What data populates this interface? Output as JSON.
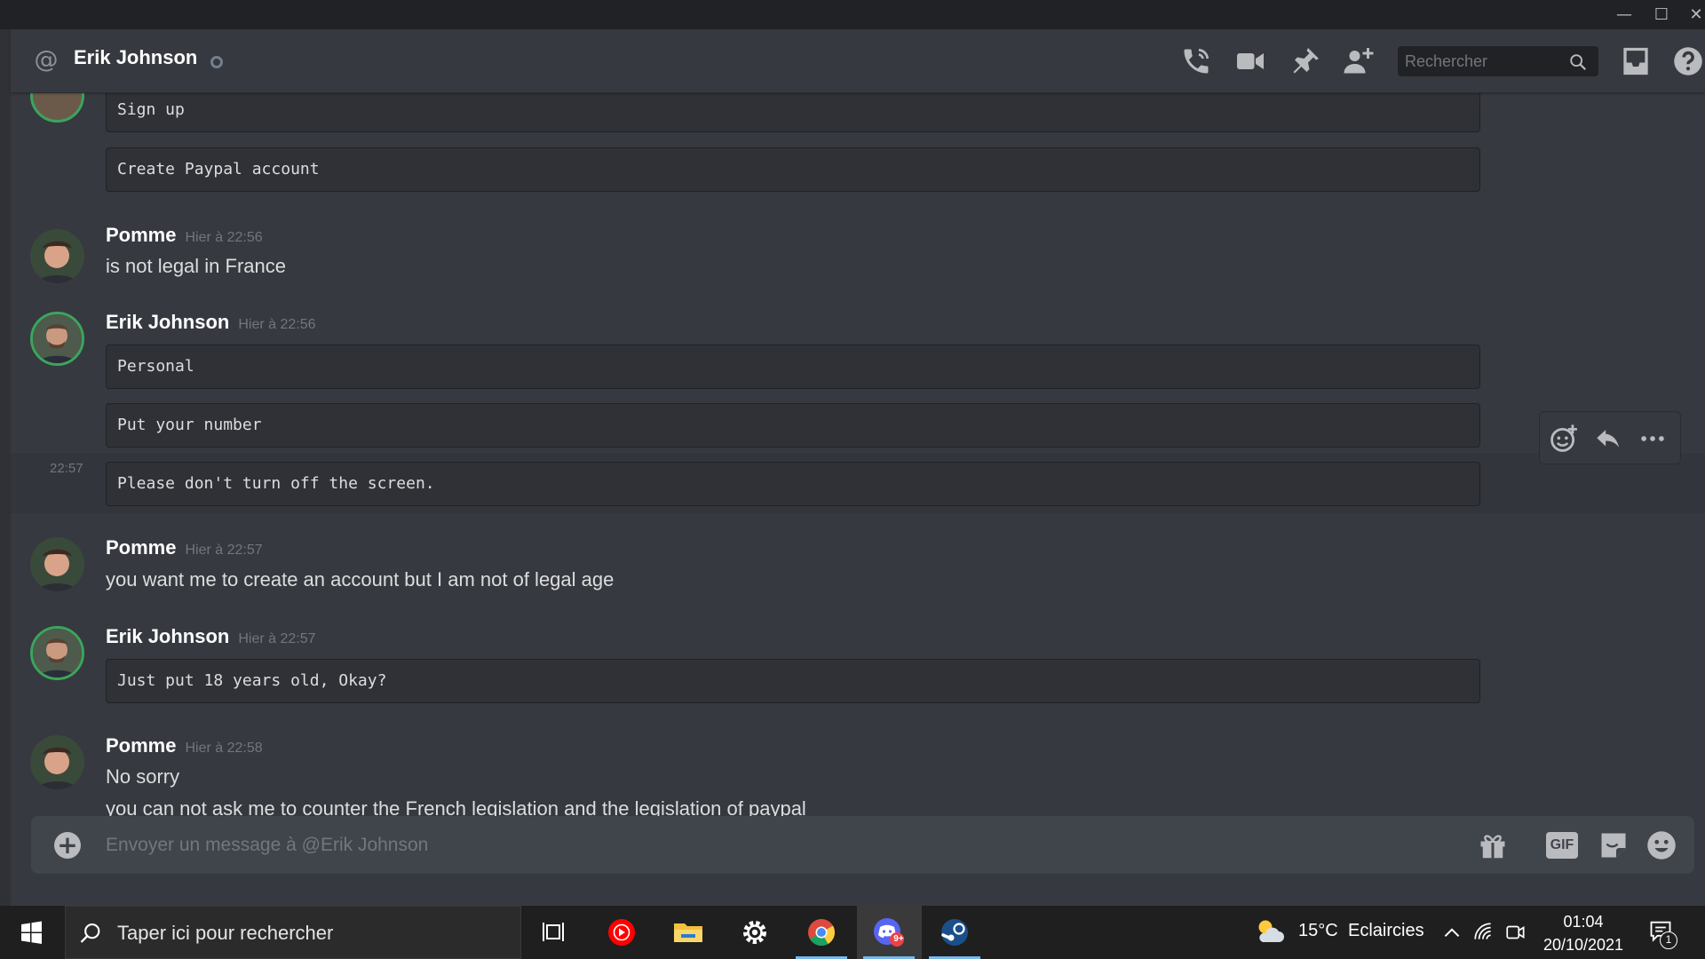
{
  "window": {
    "minimize": "—",
    "maximize": "☐",
    "close": "✕"
  },
  "header": {
    "dm_name": "Erik Johnson",
    "status": "offline",
    "search_placeholder": "Rechercher",
    "icons": [
      "call-icon",
      "video-icon",
      "pin-icon",
      "add-friend-icon",
      "search-icon",
      "inbox-icon",
      "help-icon"
    ]
  },
  "messages": {
    "prev_code_1": "Sign up",
    "prev_code_2": "Create Paypal account",
    "g1": {
      "author": "Pomme",
      "time": "Hier à 22:56",
      "text": "is not legal in France"
    },
    "g2": {
      "author": "Erik Johnson",
      "time": "Hier à 22:56",
      "code_1": "Personal",
      "code_2": "Put your number",
      "side_time": "22:57",
      "code_3": "Please don't turn off the screen."
    },
    "g3": {
      "author": "Pomme",
      "time": "Hier à 22:57",
      "text": "you want me to create an account but I am not of legal age"
    },
    "g4": {
      "author": "Erik Johnson",
      "time": "Hier à 22:57",
      "code_1": "Just put 18 years old, Okay?"
    },
    "g5": {
      "author": "Pomme",
      "time": "Hier à 22:58",
      "text_1": "No sorry",
      "text_2": "you can not ask me to counter the French legislation and the legislation of paypal"
    }
  },
  "message_actions": [
    "add-reaction-icon",
    "reply-icon",
    "more-icon"
  ],
  "composer": {
    "placeholder": "Envoyer un message à @Erik Johnson",
    "gif_label": "GIF",
    "icons": [
      "gift-icon",
      "gif-icon",
      "sticker-icon",
      "emoji-icon"
    ]
  },
  "taskbar": {
    "search_placeholder": "Taper ici pour rechercher",
    "apps": [
      "task-view-icon",
      "youtube-music-icon",
      "file-explorer-icon",
      "settings-icon",
      "chrome-icon",
      "discord-icon",
      "steam-icon"
    ],
    "discord_badge": "9+",
    "weather": {
      "temp": "15°C",
      "desc": "Eclaircies"
    },
    "clock": {
      "time": "01:04",
      "date": "20/10/2021"
    },
    "notification_count": "1"
  },
  "colors": {
    "background": "#36393f",
    "code_bg": "#2f3136",
    "accent_online": "#3ba55c",
    "timestamp": "#72767d"
  }
}
